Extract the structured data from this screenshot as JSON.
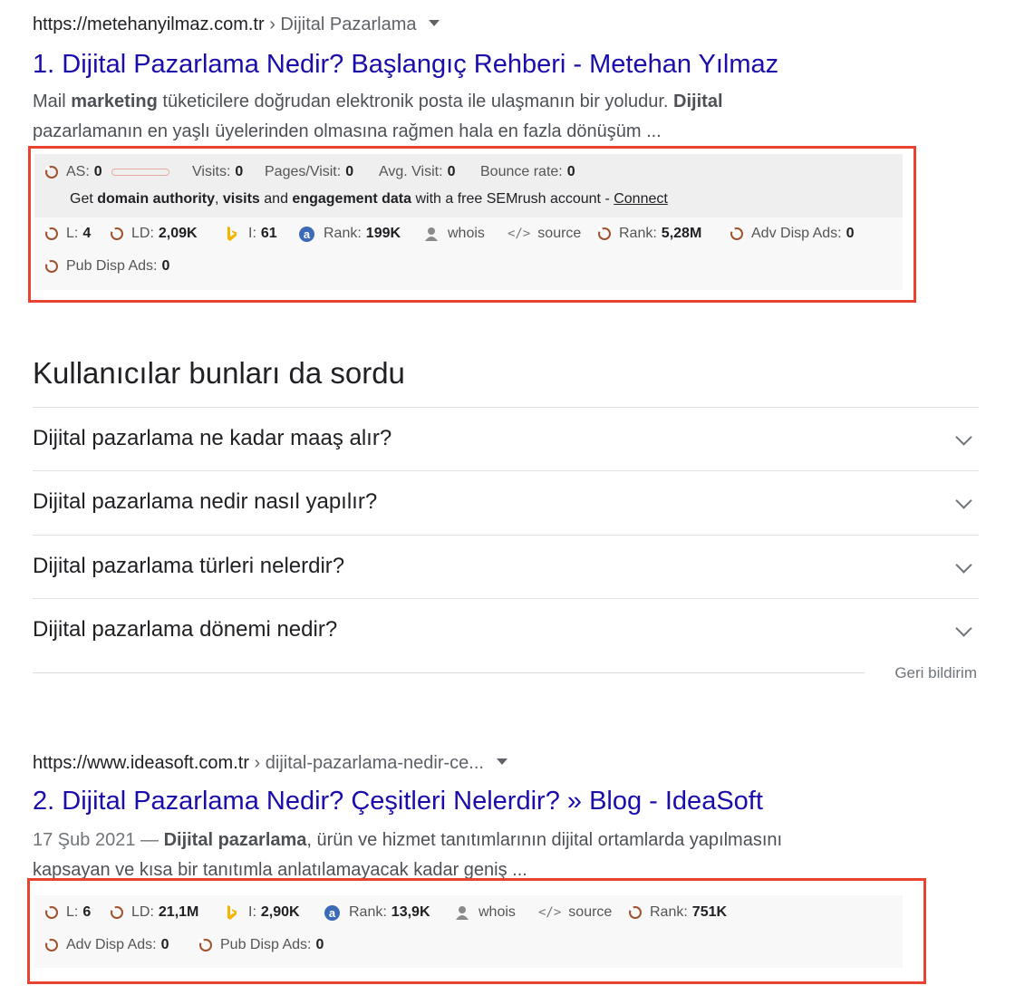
{
  "result1": {
    "url": "https://metehanyilmaz.com.tr",
    "crumb": " › Dijital Pazarlama",
    "number": "1.",
    "title": "Dijital Pazarlama Nedir? Başlangıç Rehberi - Metehan Yılmaz",
    "snippet": {
      "p1": "Mail ",
      "b1": "marketing",
      "p2": " tüketicilere doğrudan elektronik posta ile ulaşmanın bir yoludur. ",
      "b2": "Dijital",
      "p3": "pazarlamanın en yaşlı üyelerinden olmasına rağmen hala en fazla dönüşüm ..."
    },
    "seo_top": {
      "as_label": "AS:",
      "as_value": "0",
      "visits_label": "Visits:",
      "visits_value": "0",
      "pages_label": "Pages/Visit:",
      "pages_value": "0",
      "avg_label": "Avg. Visit:",
      "avg_value": "0",
      "bounce_label": "Bounce rate:",
      "bounce_value": "0",
      "get_prefix": "Get ",
      "get_b1": "domain authority",
      "get_sep1": ", ",
      "get_b2": "visits",
      "get_sep2": " and ",
      "get_b3": "engagement data",
      "get_suffix": " with a free SEMrush account - ",
      "connect": "Connect"
    },
    "seo": {
      "l_label": "L:",
      "l_value": "4",
      "ld_label": "LD:",
      "ld_value": "2,09K",
      "i_label": "I:",
      "i_value": "61",
      "rank_label": "Rank:",
      "rank_value": "199K",
      "whois": "whois",
      "source": "source",
      "rank2_label": "Rank:",
      "rank2_value": "5,28M",
      "adv_label": "Adv Disp Ads:",
      "adv_value": "0",
      "pub_label": "Pub Disp Ads:",
      "pub_value": "0"
    }
  },
  "paa": {
    "heading": "Kullanıcılar bunları da sordu",
    "questions": [
      "Dijital pazarlama ne kadar maaş alır?",
      "Dijital pazarlama nedir nasıl yapılır?",
      "Dijital pazarlama türleri nelerdir?",
      "Dijital pazarlama dönemi nedir?"
    ],
    "feedback": "Geri bildirim"
  },
  "result2": {
    "url": "https://www.ideasoft.com.tr",
    "crumb": " › dijital-pazarlama-nedir-ce...",
    "number": "2.",
    "title": "Dijital Pazarlama Nedir? Çeşitleri Nelerdir? » Blog - IdeaSoft",
    "snippet": {
      "date": "17 Şub 2021 — ",
      "b1": "Dijital pazarlama",
      "p1": ", ürün ve hizmet tanıtımlarının dijital ortamlarda yapılmasını",
      "p2": "kapsayan ve kısa bir tanıtımla anlatılamayacak kadar geniş ..."
    },
    "seo": {
      "l_label": "L:",
      "l_value": "6",
      "ld_label": "LD:",
      "ld_value": "21,1M",
      "i_label": "I:",
      "i_value": "2,90K",
      "rank_label": "Rank:",
      "rank_value": "13,9K",
      "whois": "whois",
      "source": "source",
      "rank2_label": "Rank:",
      "rank2_value": "751K",
      "adv_label": "Adv Disp Ads:",
      "adv_value": "0",
      "pub_label": "Pub Disp Ads:",
      "pub_value": "0"
    }
  },
  "colors": {
    "link": "#1a0dab",
    "highlight_box": "#e84330",
    "semrush_icon": "#a0522d",
    "bing_icon": "#f4b400",
    "alexa_icon": "#3b6ab8"
  }
}
